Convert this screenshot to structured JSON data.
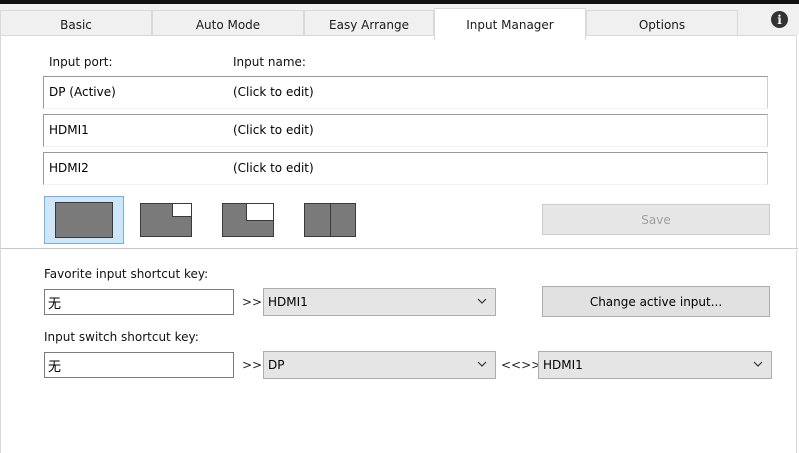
{
  "tabs": [
    {
      "label": "Basic",
      "active": false
    },
    {
      "label": "Auto Mode",
      "active": false
    },
    {
      "label": "Easy Arrange",
      "active": false
    },
    {
      "label": "Input Manager",
      "active": true
    },
    {
      "label": "Options",
      "active": false
    }
  ],
  "info_icon_glyph": "i",
  "input_table": {
    "port_header": "Input port:",
    "name_header": "Input name:",
    "rows": [
      {
        "port": "DP (Active)",
        "name": "(Click to edit)"
      },
      {
        "port": "HDMI1",
        "name": "(Click to edit)"
      },
      {
        "port": "HDMI2",
        "name": "(Click to edit)"
      }
    ]
  },
  "layouts": [
    {
      "icon": "layout-full-icon",
      "selected": true
    },
    {
      "icon": "layout-pip-top-right-small-icon",
      "selected": false
    },
    {
      "icon": "layout-pip-top-right-large-icon",
      "selected": false
    },
    {
      "icon": "layout-split-vertical-icon",
      "selected": false
    }
  ],
  "save_label": "Save",
  "favorite": {
    "label": "Favorite input shortcut key:",
    "key_value": "无",
    "arrow": ">>",
    "selected_input": "HDMI1",
    "button_label": "Change active input..."
  },
  "switch": {
    "label": "Input switch shortcut key:",
    "key_value": "无",
    "arrow": ">>",
    "first_input": "DP",
    "swap_symbol": "<<>>",
    "second_input": "HDMI1"
  },
  "colors": {
    "selected_bg": "#cfe6f8",
    "selected_border": "#70b0e3",
    "button_bg": "#e1e1e1",
    "layout_fill": "#7a7a7a"
  }
}
